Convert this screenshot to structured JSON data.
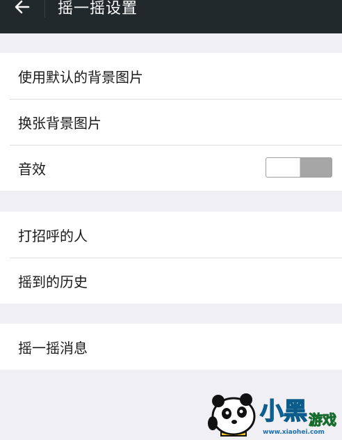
{
  "header": {
    "title": "摇一摇设置",
    "back_icon": "back-arrow-icon"
  },
  "groups": [
    {
      "items": [
        {
          "label": "使用默认的背景图片"
        },
        {
          "label": "换张背景图片"
        },
        {
          "label": "音效",
          "toggle": {
            "on": false
          }
        }
      ]
    },
    {
      "items": [
        {
          "label": "打招呼的人"
        },
        {
          "label": "摇到的历史"
        }
      ]
    },
    {
      "items": [
        {
          "label": "摇一摇消息"
        }
      ]
    }
  ],
  "colors": {
    "topbar": "#22292c",
    "background": "#efeff4",
    "row_bg": "#ffffff",
    "divider": "#dcdcdc",
    "toggle_off": "#a6a6a6",
    "watermark_blue": "#1aa0e6",
    "watermark_green": "#2bb24c"
  },
  "watermark": {
    "text_big": "小黑",
    "text_small": "游戏",
    "url": "www.xiaohei.com"
  }
}
